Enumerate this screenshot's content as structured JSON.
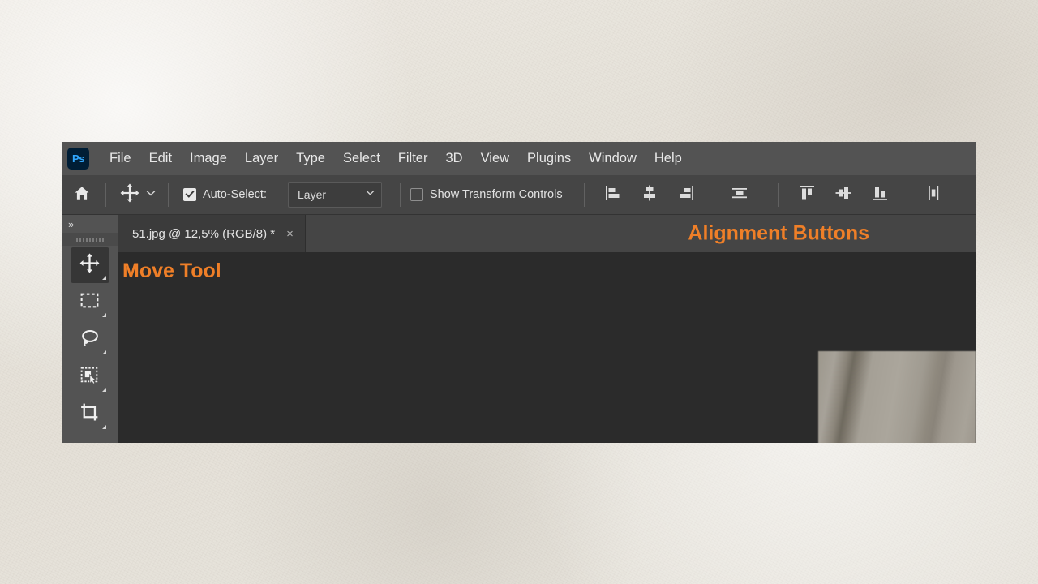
{
  "app": {
    "logo_text": "Ps",
    "logo_bg": "#001e36",
    "logo_fg": "#31a8ff"
  },
  "menubar": {
    "items": [
      {
        "label": "File"
      },
      {
        "label": "Edit"
      },
      {
        "label": "Image"
      },
      {
        "label": "Layer"
      },
      {
        "label": "Type"
      },
      {
        "label": "Select"
      },
      {
        "label": "Filter"
      },
      {
        "label": "3D"
      },
      {
        "label": "View"
      },
      {
        "label": "Plugins"
      },
      {
        "label": "Window"
      },
      {
        "label": "Help"
      }
    ]
  },
  "options_bar": {
    "home_icon": "home-icon",
    "tool_icon": "move-tool-icon",
    "tool_preset_chevron": "chevron-down-icon",
    "auto_select": {
      "label": "Auto-Select:",
      "checked": true
    },
    "auto_select_target": {
      "value": "Layer",
      "chevron": "chevron-down-icon"
    },
    "show_transform_controls": {
      "label": "Show Transform Controls",
      "checked": false
    },
    "align_buttons_left_group": [
      {
        "name": "align-left-edges",
        "title": "Align left edges"
      },
      {
        "name": "align-horizontal-centers",
        "title": "Align horizontal centers"
      },
      {
        "name": "align-right-edges",
        "title": "Align right edges"
      },
      {
        "name": "distribute-vertical-centers",
        "title": "Distribute vertical centers"
      }
    ],
    "align_buttons_right_group": [
      {
        "name": "align-top-edges",
        "title": "Align top edges"
      },
      {
        "name": "align-vertical-centers",
        "title": "Align vertical centers"
      },
      {
        "name": "align-bottom-edges",
        "title": "Align bottom edges"
      },
      {
        "name": "distribute-horizontal-centers",
        "title": "Distribute horizontal centers"
      }
    ]
  },
  "toolbar": {
    "expand_label": "»",
    "grip": "drag-handle-dots",
    "tools": [
      {
        "name": "move-tool",
        "icon": "move-tool-icon",
        "selected": true
      },
      {
        "name": "rectangular-marquee-tool",
        "icon": "marquee-icon",
        "selected": false
      },
      {
        "name": "lasso-tool",
        "icon": "lasso-icon",
        "selected": false
      },
      {
        "name": "object-selection-tool",
        "icon": "object-selection-icon",
        "selected": false
      },
      {
        "name": "crop-tool",
        "icon": "crop-icon",
        "selected": false
      }
    ]
  },
  "document_tab": {
    "title": "51.jpg @ 12,5% (RGB/8) *",
    "close_glyph": "×"
  },
  "annotations": {
    "move_tool": "Move Tool",
    "alignment_buttons": "Alignment Buttons",
    "color": "#ef7f28"
  },
  "canvas": {
    "photo_alt": "partial-photo-thumbnail"
  }
}
